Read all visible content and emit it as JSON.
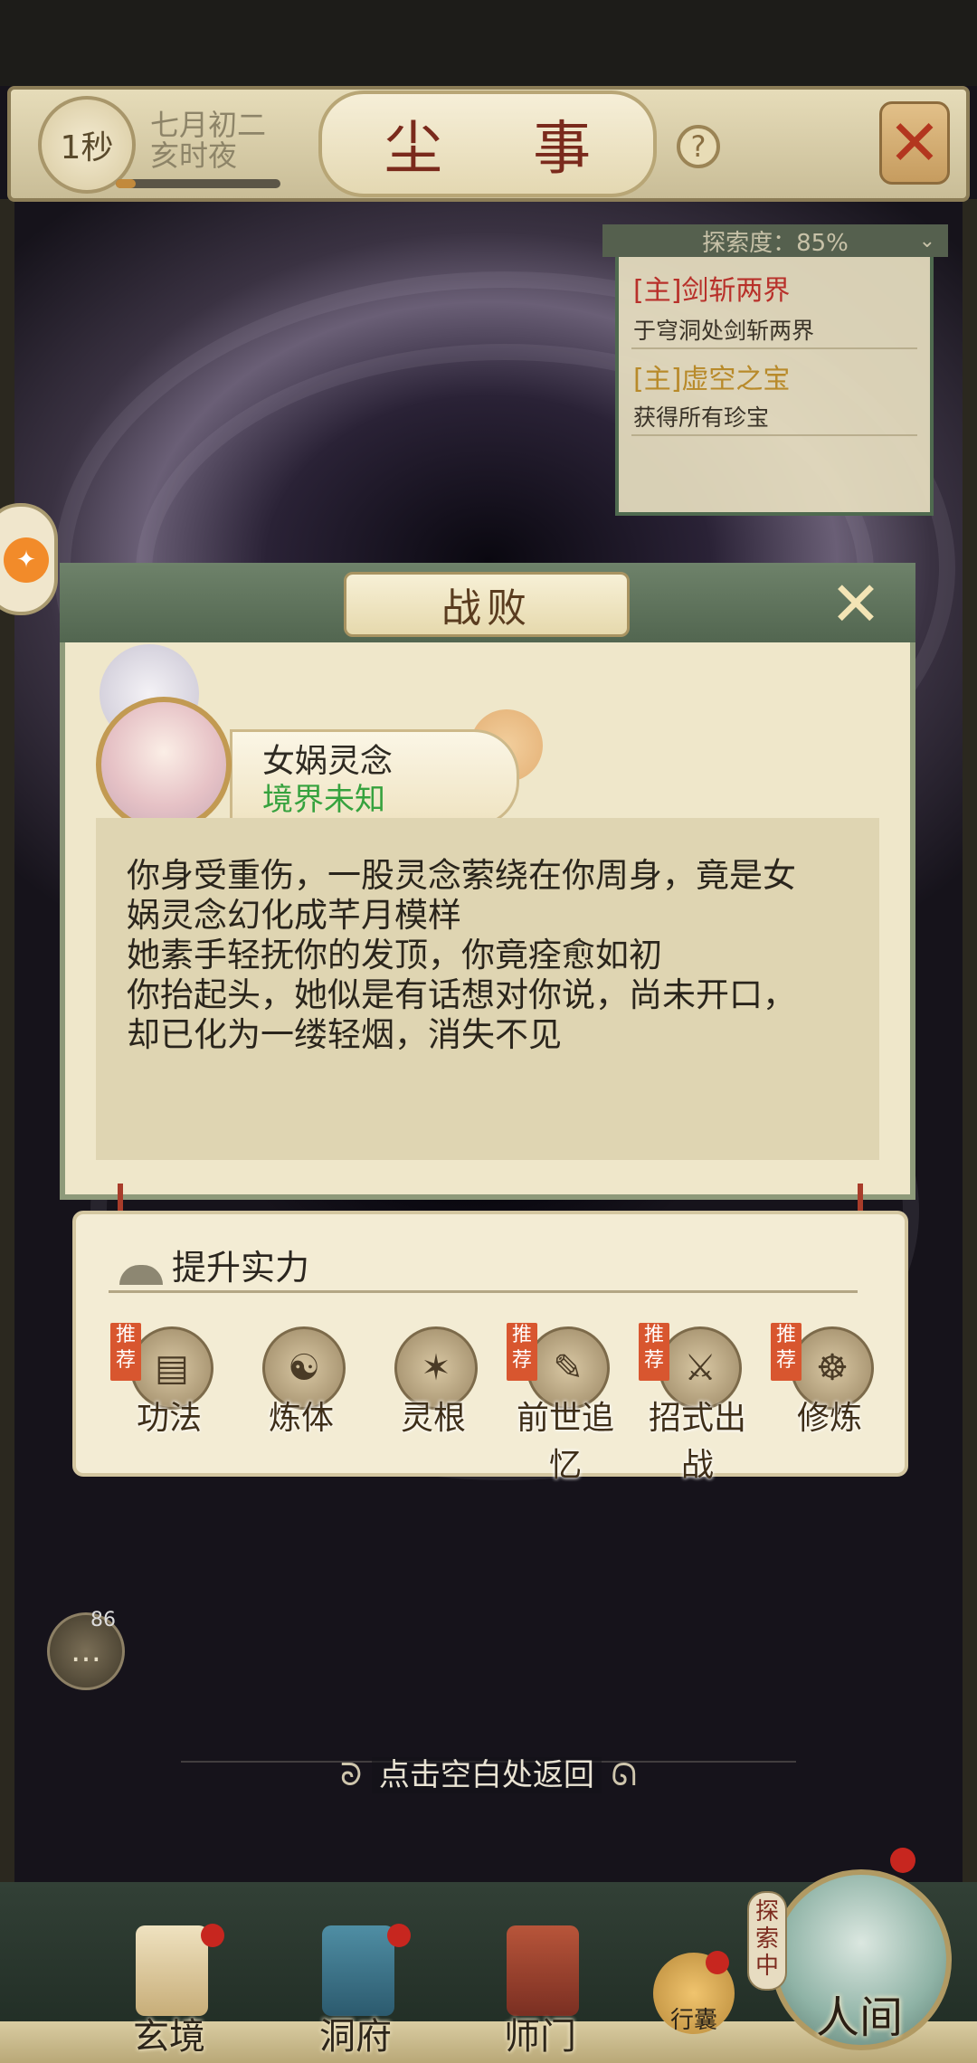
{
  "top_bar": {
    "timer": "1秒",
    "date_line1": "七月初二",
    "date_line2": "亥时夜",
    "title": "尘 事",
    "help": "?"
  },
  "quest_panel": {
    "exploration": "探索度：85%",
    "quests": [
      {
        "title": "[主]剑斩两界",
        "desc": "于穹洞处剑斩两界",
        "color": "#b8302a"
      },
      {
        "title": "[主]虚空之宝",
        "desc": "获得所有珍宝",
        "color": "#b88a2a"
      }
    ]
  },
  "dialog": {
    "title": "战败",
    "npc_name": "女娲灵念",
    "npc_realm": "境界未知",
    "story_lines": [
      "你身受重伤，一股灵念萦绕在你周身，竟是女",
      "娲灵念幻化成芊月模样",
      "她素手轻抚你的发顶，你竟痊愈如初",
      "你抬起头，她似是有话想对你说，尚未开口，",
      "却已化为一缕轻烟，消失不见"
    ]
  },
  "improve": {
    "header": "提升实力",
    "recommend_tag": "推荐",
    "items": [
      {
        "label": "功法",
        "recommended": true,
        "icon": "scroll-icon"
      },
      {
        "label": "炼体",
        "recommended": false,
        "icon": "body-training-icon"
      },
      {
        "label": "灵根",
        "recommended": false,
        "icon": "spirit-root-icon"
      },
      {
        "label": "前世追忆",
        "recommended": true,
        "icon": "past-life-icon"
      },
      {
        "label": "招式出战",
        "recommended": true,
        "icon": "sword-skill-icon"
      },
      {
        "label": "修炼",
        "recommended": true,
        "icon": "meditation-icon"
      }
    ]
  },
  "chat": {
    "badge": "86"
  },
  "back_hint": "点击空白处返回",
  "nav": {
    "items": [
      {
        "label": "玄境",
        "icon": "scroll-realm-icon"
      },
      {
        "label": "洞府",
        "icon": "pavilion-icon"
      },
      {
        "label": "师门",
        "icon": "banner-icon"
      }
    ],
    "bag": "行囊",
    "exploring": "探索中",
    "mortal": "人间"
  }
}
